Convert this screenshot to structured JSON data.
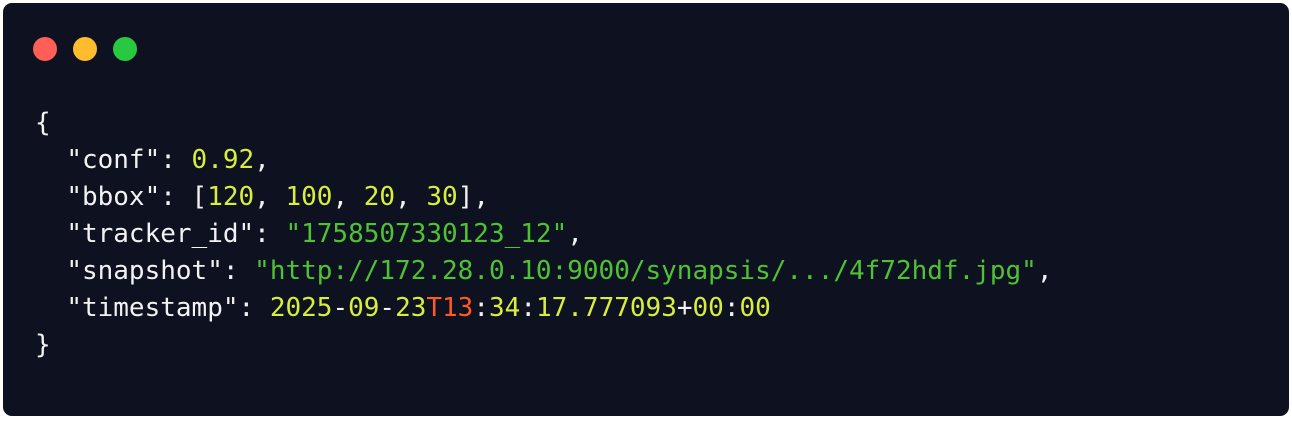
{
  "window": {
    "buttons": [
      {
        "name": "close",
        "color": "#ff5f57"
      },
      {
        "name": "minimize",
        "color": "#febc2e"
      },
      {
        "name": "maximize",
        "color": "#28c840"
      }
    ]
  },
  "colors": {
    "background": "#0e1120",
    "default": "#f2f2f2",
    "number": "#d7ee3c",
    "string": "#4fc234",
    "accent": "#ff5a1f"
  },
  "code_lines": [
    [
      {
        "t": "{",
        "c": "default"
      }
    ],
    [
      {
        "t": "  ",
        "c": "default"
      },
      {
        "t": "\"conf\"",
        "c": "default"
      },
      {
        "t": ": ",
        "c": "default"
      },
      {
        "t": "0.92",
        "c": "number"
      },
      {
        "t": ",",
        "c": "default"
      }
    ],
    [
      {
        "t": "  ",
        "c": "default"
      },
      {
        "t": "\"bbox\"",
        "c": "default"
      },
      {
        "t": ": [",
        "c": "default"
      },
      {
        "t": "120",
        "c": "number"
      },
      {
        "t": ", ",
        "c": "default"
      },
      {
        "t": "100",
        "c": "number"
      },
      {
        "t": ", ",
        "c": "default"
      },
      {
        "t": "20",
        "c": "number"
      },
      {
        "t": ", ",
        "c": "default"
      },
      {
        "t": "30",
        "c": "number"
      },
      {
        "t": "],",
        "c": "default"
      }
    ],
    [
      {
        "t": "  ",
        "c": "default"
      },
      {
        "t": "\"tracker_id\"",
        "c": "default"
      },
      {
        "t": ": ",
        "c": "default"
      },
      {
        "t": "\"1758507330123_12\"",
        "c": "string"
      },
      {
        "t": ",",
        "c": "default"
      }
    ],
    [
      {
        "t": "  ",
        "c": "default"
      },
      {
        "t": "\"snapshot\"",
        "c": "default"
      },
      {
        "t": ": ",
        "c": "default"
      },
      {
        "t": "\"http://172.28.0.10:9000/synapsis/.../4f72hdf.jpg\"",
        "c": "string"
      },
      {
        "t": ",",
        "c": "default"
      }
    ],
    [
      {
        "t": "  ",
        "c": "default"
      },
      {
        "t": "\"timestamp\"",
        "c": "default"
      },
      {
        "t": ": ",
        "c": "default"
      },
      {
        "t": "2025",
        "c": "number"
      },
      {
        "t": "-",
        "c": "default"
      },
      {
        "t": "09",
        "c": "number"
      },
      {
        "t": "-",
        "c": "default"
      },
      {
        "t": "23",
        "c": "number"
      },
      {
        "t": "T13",
        "c": "accent"
      },
      {
        "t": ":",
        "c": "default"
      },
      {
        "t": "34",
        "c": "number"
      },
      {
        "t": ":",
        "c": "default"
      },
      {
        "t": "17.777093",
        "c": "number"
      },
      {
        "t": "+",
        "c": "default"
      },
      {
        "t": "00",
        "c": "number"
      },
      {
        "t": ":",
        "c": "default"
      },
      {
        "t": "00",
        "c": "number"
      }
    ],
    [
      {
        "t": "}",
        "c": "default"
      }
    ]
  ]
}
